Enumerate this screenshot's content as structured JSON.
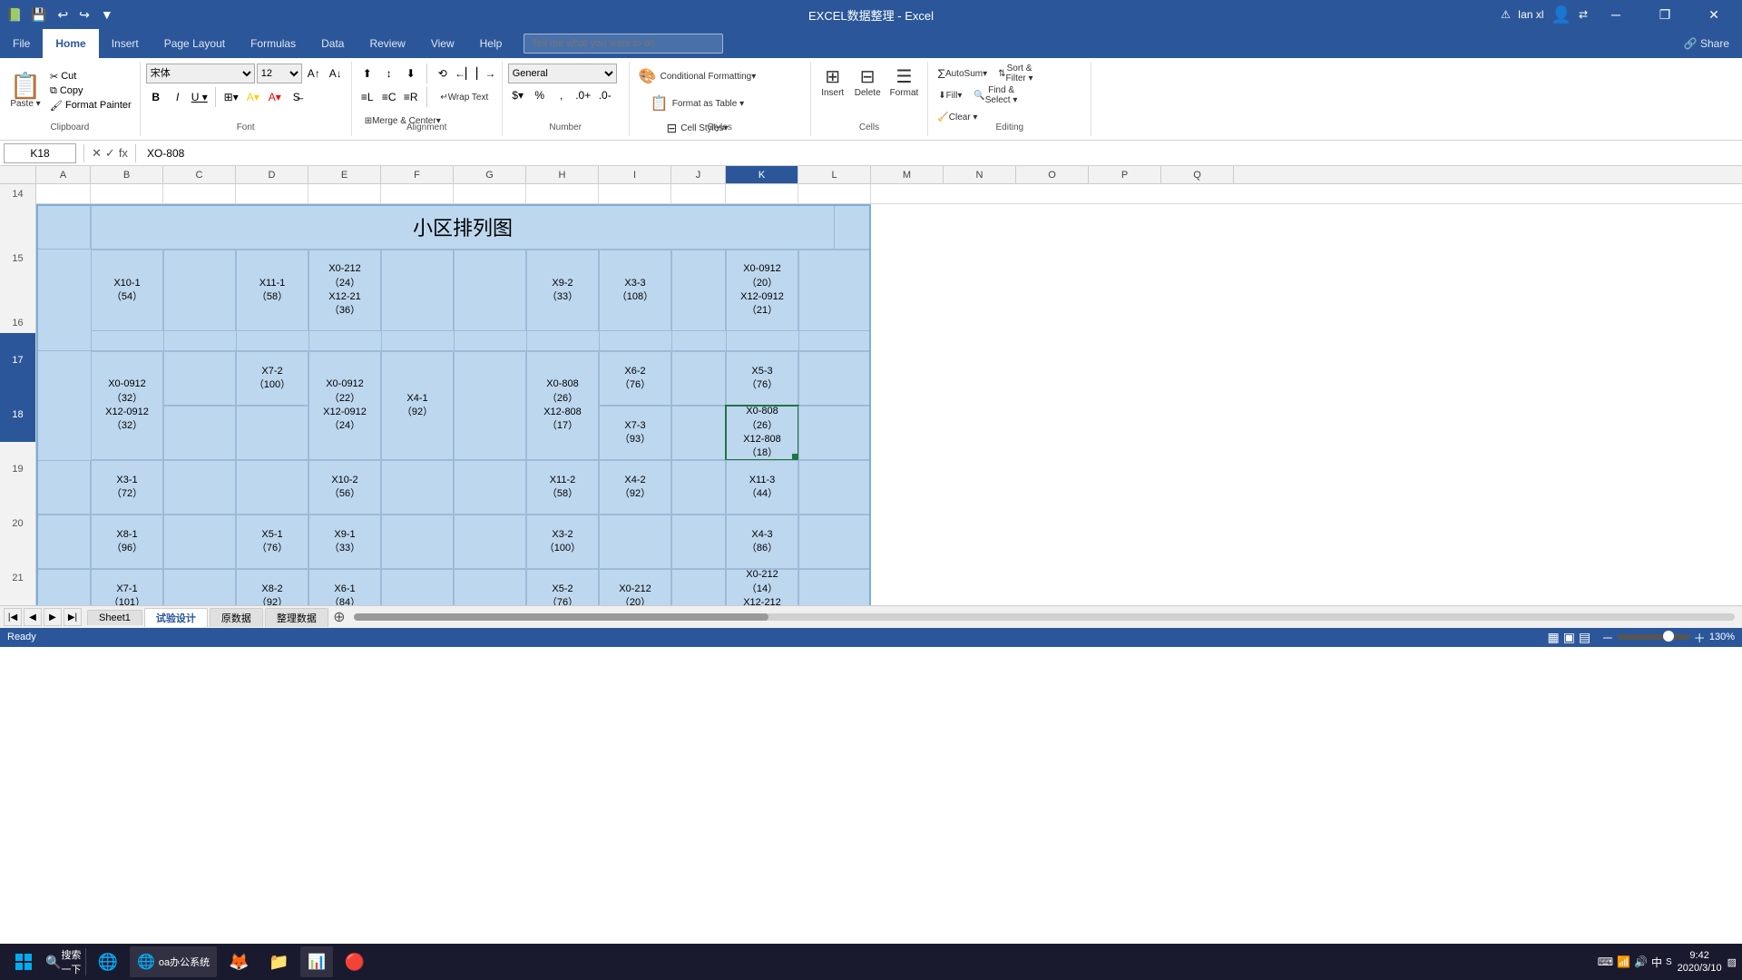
{
  "titlebar": {
    "title": "EXCEL数据整理 - Excel",
    "save_icon": "💾",
    "undo_icon": "↩",
    "redo_icon": "↪",
    "customize_icon": "▼",
    "warning_icon": "⚠",
    "user": "Ian xl",
    "min_icon": "─",
    "restore_icon": "❐",
    "close_icon": "✕"
  },
  "ribbon": {
    "tabs": [
      "File",
      "Home",
      "Insert",
      "Page Layout",
      "Formulas",
      "Data",
      "Review",
      "View",
      "Help"
    ],
    "active_tab": "Home",
    "tell_me": "Tell me what you want to do",
    "share_label": "Share",
    "groups": {
      "clipboard": {
        "label": "Clipboard",
        "paste_label": "Paste",
        "copy_label": "Copy",
        "cut_label": "Cut",
        "format_painter_label": "Format Painter"
      },
      "font": {
        "label": "Font",
        "font_name": "宋体",
        "font_size": "12",
        "bold": "B",
        "italic": "I",
        "underline": "U",
        "border": "⊞",
        "fill_color": "A",
        "font_color": "A"
      },
      "alignment": {
        "label": "Alignment",
        "wrap_text": "Wrap Text",
        "merge_center": "Merge & Center"
      },
      "number": {
        "label": "Number",
        "format": "General"
      },
      "styles": {
        "label": "Styles",
        "conditional_formatting": "Conditional Formatting",
        "format_as_table": "Format as Table",
        "cell_styles": "Cell Styles"
      },
      "cells": {
        "label": "Cells",
        "insert": "Insert",
        "delete": "Delete",
        "format": "Format"
      },
      "editing": {
        "label": "Editing",
        "autosum": "AutoSum",
        "fill": "Fill",
        "clear": "Clear",
        "sort_filter": "Sort & Filter",
        "find_select": "Find & Select"
      }
    }
  },
  "formula_bar": {
    "name_box": "K18",
    "formula_value": "XO-808",
    "cancel_icon": "✕",
    "confirm_icon": "✓",
    "fx_icon": "fx"
  },
  "columns": [
    "A",
    "B",
    "C",
    "D",
    "E",
    "F",
    "G",
    "H",
    "I",
    "J",
    "K",
    "L",
    "M",
    "N",
    "O",
    "P",
    "Q"
  ],
  "rows": {
    "row14": "14",
    "row15": "15",
    "row16": "16",
    "row17": "17",
    "row18": "18",
    "row19": "19",
    "row20": "20",
    "row21": "21"
  },
  "table_title": "小区排列图",
  "cells": {
    "r15_B": "X10-1\n（54）",
    "r15_D": "X11-1\n（58）",
    "r15_E": "X0-212\n（24）\nX12-21\n（36）",
    "r15_G": "",
    "r15_H": "X9-2\n（33）",
    "r15_I": "X3-3\n（108）",
    "r15_K": "X0-0912\n（20）\nX12-0912\n（21）",
    "r17_B": "X0-0912\n（32）\nX12-0912\n（32）",
    "r17_D": "X7-2\n（100）",
    "r17_E": "X0-0912\n（22）\nX12-0912\n（24）",
    "r17_F": "X4-1\n（92）",
    "r17_G": "",
    "r17_H": "X0-808\n（26）\nX12-808\n（17）",
    "r17_I": "X6-2\n（76）",
    "r17_J": "",
    "r17_K": "X5-3\n（76）",
    "r18_K": "X0-808\n（26）\nX12-808\n（18）",
    "r18_I": "X7-3\n（93）",
    "r19_B": "X3-1\n（72）",
    "r19_E": "X10-2\n（56）",
    "r19_H": "X11-2\n（58）",
    "r19_I": "X4-2\n（92）",
    "r19_K": "X11-3\n（44）",
    "r20_B": "X8-1\n（96）",
    "r20_D": "X5-1\n（76）",
    "r20_E": "X9-1\n（33）",
    "r20_H": "X3-2\n（100）",
    "r20_K": "X4-3\n（86）",
    "r21_B": "X7-1\n（101）",
    "r21_D": "X8-2\n（92）",
    "r21_E": "X6-1\n（84）",
    "r21_H": "X5-2\n（76）",
    "r21_I": "X0-212\n（20）",
    "r21_K": "X0-212\n（14）\nX12-212\n..."
  },
  "sheet_tabs": {
    "tabs": [
      "Sheet1",
      "试验设计",
      "原数据",
      "整理数据"
    ],
    "active": "试验设计"
  },
  "status_bar": {
    "status": "Ready",
    "view_normal": "▦",
    "view_page": "▣",
    "view_custom": "▤",
    "zoom": "130",
    "zoom_percent": "%"
  },
  "taskbar": {
    "start_icon": "⊞",
    "search_placeholder": "搜索一下",
    "apps": [
      {
        "name": "File Explorer",
        "icon": "📁"
      },
      {
        "name": "Firefox",
        "icon": "🦊"
      },
      {
        "name": "Edge Browser",
        "icon": "🌐"
      },
      {
        "name": "Excel",
        "icon": "📊"
      },
      {
        "name": "App5",
        "icon": "🔴"
      }
    ],
    "clock_time": "9:42",
    "clock_date": "2020/3/10"
  }
}
